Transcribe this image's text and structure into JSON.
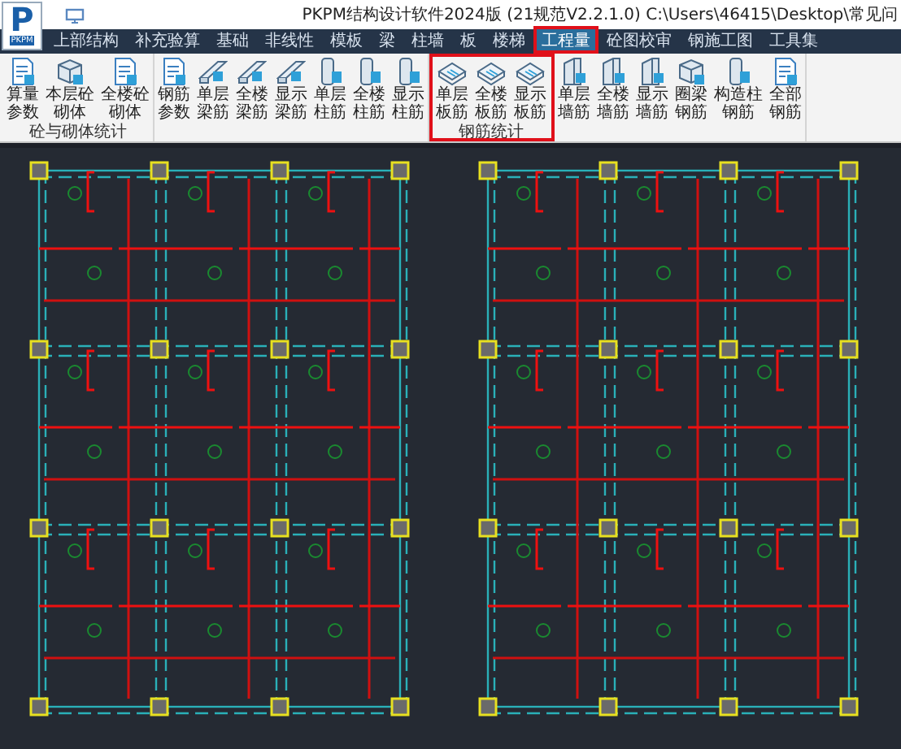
{
  "app": {
    "logo": "P",
    "logo_caption": "PKPM"
  },
  "window": {
    "title": "PKPM结构设计软件2024版 (21规范V2.2.1.0) C:\\Users\\46415\\Desktop\\常见问"
  },
  "tabs": [
    {
      "label": "上部结构",
      "selected": false
    },
    {
      "label": "补充验算",
      "selected": false
    },
    {
      "label": "基础",
      "selected": false
    },
    {
      "label": "非线性",
      "selected": false
    },
    {
      "label": "模板",
      "selected": false
    },
    {
      "label": "梁",
      "selected": false
    },
    {
      "label": "柱墙",
      "selected": false
    },
    {
      "label": "板",
      "selected": false
    },
    {
      "label": "楼梯",
      "selected": false
    },
    {
      "label": "工程量",
      "selected": true
    },
    {
      "label": "砼图校审",
      "selected": false
    },
    {
      "label": "钢施工图",
      "selected": false
    },
    {
      "label": "工具集",
      "selected": false
    }
  ],
  "ribbon_groups": [
    {
      "label": "砼与砌体统计",
      "highlighted": false,
      "buttons": [
        {
          "label": "算量参数",
          "kind": "doc"
        },
        {
          "label": "本层砼砌体",
          "kind": "cube"
        },
        {
          "label": "全楼砼砌体",
          "kind": "doc"
        }
      ]
    },
    {
      "highlighted": false,
      "buttons": [
        {
          "label": "钢筋参数",
          "kind": "doc"
        },
        {
          "label": "单层梁筋",
          "kind": "beam"
        },
        {
          "label": "全楼梁筋",
          "kind": "beam"
        },
        {
          "label": "显示梁筋",
          "kind": "beam"
        },
        {
          "label": "单层柱筋",
          "kind": "column"
        },
        {
          "label": "全楼柱筋",
          "kind": "column"
        },
        {
          "label": "显示柱筋",
          "kind": "column"
        }
      ]
    },
    {
      "label": "钢筋统计",
      "highlighted": true,
      "buttons": [
        {
          "label": "单层板筋",
          "kind": "slab"
        },
        {
          "label": "全楼板筋",
          "kind": "slab"
        },
        {
          "label": "显示板筋",
          "kind": "slab"
        }
      ]
    },
    {
      "highlighted": false,
      "buttons": [
        {
          "label": "单层墙筋",
          "kind": "wall"
        },
        {
          "label": "全楼墙筋",
          "kind": "wall"
        },
        {
          "label": "显示墙筋",
          "kind": "wall"
        },
        {
          "label": "圈梁钢筋",
          "kind": "cube"
        },
        {
          "label": "构造柱钢筋",
          "kind": "column"
        },
        {
          "label": "全部钢筋",
          "kind": "doc"
        }
      ]
    }
  ]
}
